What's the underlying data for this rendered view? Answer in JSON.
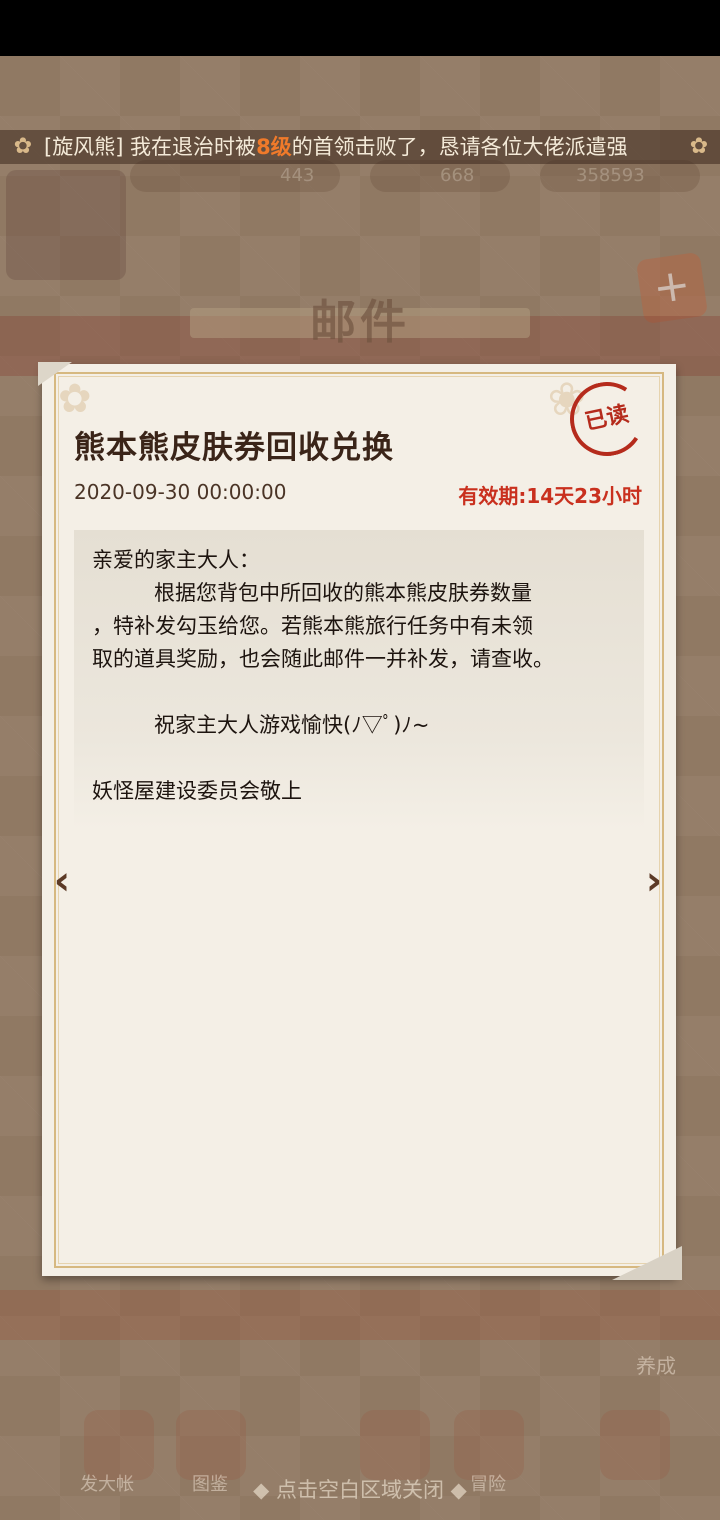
{
  "ticker": {
    "prefix": "[旋风熊] 我在退治时被",
    "highlight": "8级",
    "suffix": "的首领击败了，恳请各位大佬派遣强"
  },
  "header": {
    "title": "邮件"
  },
  "hud": {
    "value_left": "443",
    "value_mid": "668",
    "value_right": "358593"
  },
  "mail": {
    "title": "熊本熊皮肤券回收兑换",
    "date": "2020-09-30 00:00:00",
    "validity": "有效期:14天23小时",
    "status_stamp": "已读",
    "greeting": "亲爱的家主大人：",
    "paragraph_1_line_1": "根据您背包中所回收的熊本熊皮肤券数量",
    "paragraph_1_line_2": "，特补发勾玉给您。若熊本熊旅行任务中有未领",
    "paragraph_1_line_3": "取的道具奖励，也会随此邮件一并补发，请查收。",
    "wish": "祝家主大人游戏愉快(ﾉ▽ﾟ)ﾉ~",
    "signature": "妖怪屋建设委员会敬上"
  },
  "nav": {
    "prev_icon": "chevron-left-icon",
    "next_icon": "chevron-right-icon"
  },
  "bottom": {
    "side_label": "养成",
    "icon_label_1": "发大帐",
    "icon_label_2": "图鉴",
    "icon_label_5": "冒险",
    "close_hint": "◆ 点击空白区域关闭 ◆"
  },
  "colors": {
    "accent_red": "#c9301e",
    "paper": "#f4efe6",
    "border_gold": "#d6b880"
  }
}
